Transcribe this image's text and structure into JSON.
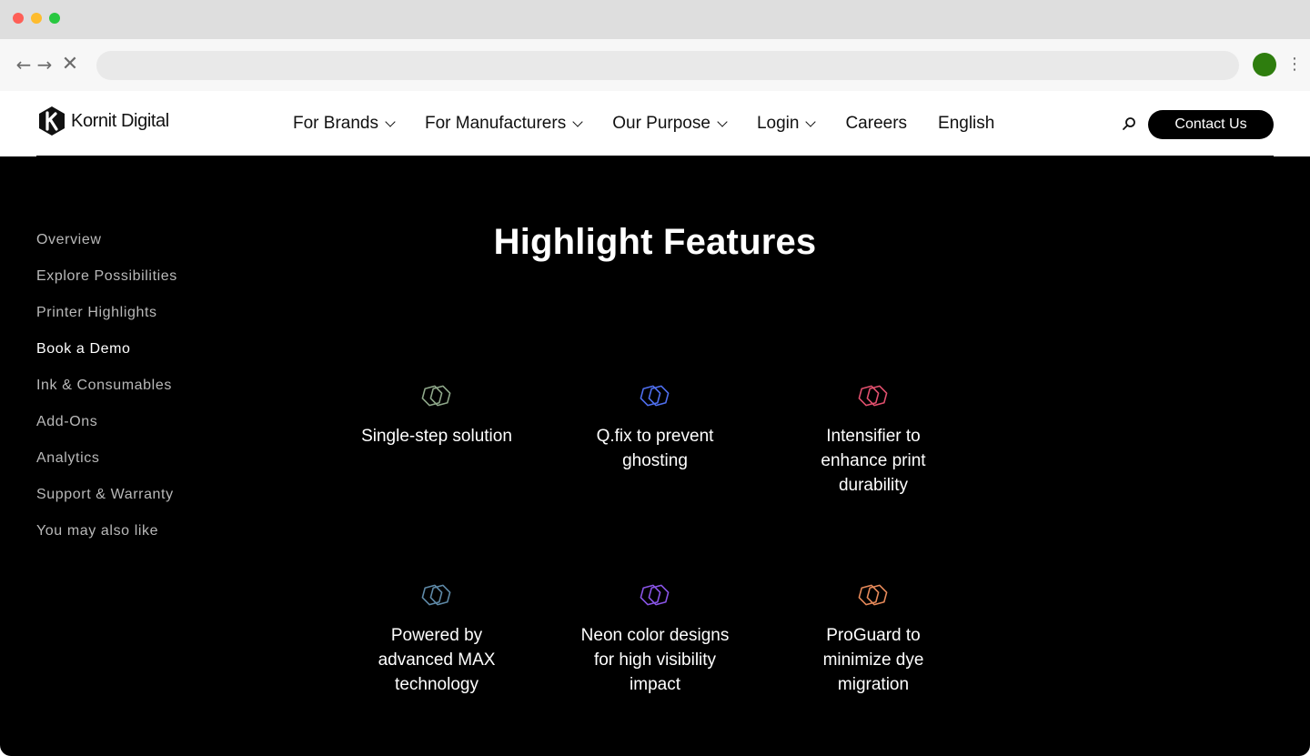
{
  "browser": {
    "back_icon": "←",
    "forward_icon": "→",
    "stop_icon": "✕",
    "menu_icon": "⋮",
    "profile_color": "#2e7d0e"
  },
  "header": {
    "logo_text": "Kornit Digital",
    "nav": [
      {
        "label": "For Brands",
        "dropdown": true
      },
      {
        "label": "For Manufacturers",
        "dropdown": true
      },
      {
        "label": "Our Purpose",
        "dropdown": true
      },
      {
        "label": "Login",
        "dropdown": true
      },
      {
        "label": "Careers",
        "dropdown": false
      },
      {
        "label": "English",
        "dropdown": false
      }
    ],
    "contact_label": "Contact Us"
  },
  "sidebar": {
    "items": [
      {
        "label": "Overview",
        "active": false
      },
      {
        "label": "Explore Possibilities",
        "active": false
      },
      {
        "label": "Printer Highlights",
        "active": false
      },
      {
        "label": "Book a Demo",
        "active": true
      },
      {
        "label": "Ink & Consumables",
        "active": false
      },
      {
        "label": "Add-Ons",
        "active": false
      },
      {
        "label": "Analytics",
        "active": false
      },
      {
        "label": "Support & Warranty",
        "active": false
      },
      {
        "label": "You may also like",
        "active": false
      }
    ]
  },
  "section": {
    "title": "Highlight Features",
    "features": [
      {
        "label": "Single-step solution",
        "icon": "hexagons-icon",
        "color": "#8fa88a"
      },
      {
        "label": "Q.fix to prevent ghosting",
        "icon": "hexagons-icon",
        "color": "#4f6ff0"
      },
      {
        "label": "Intensifier to enhance print durability",
        "icon": "hexagons-icon",
        "color": "#e2506e"
      },
      {
        "label": "Powered by advanced MAX technology",
        "icon": "hexagons-icon",
        "color": "#5f8aa8"
      },
      {
        "label": "Neon color designs for high visibility impact",
        "icon": "hexagons-icon",
        "color": "#8a55e8"
      },
      {
        "label": "ProGuard to minimize dye migration",
        "icon": "hexagons-icon",
        "color": "#e88a5a"
      }
    ]
  }
}
